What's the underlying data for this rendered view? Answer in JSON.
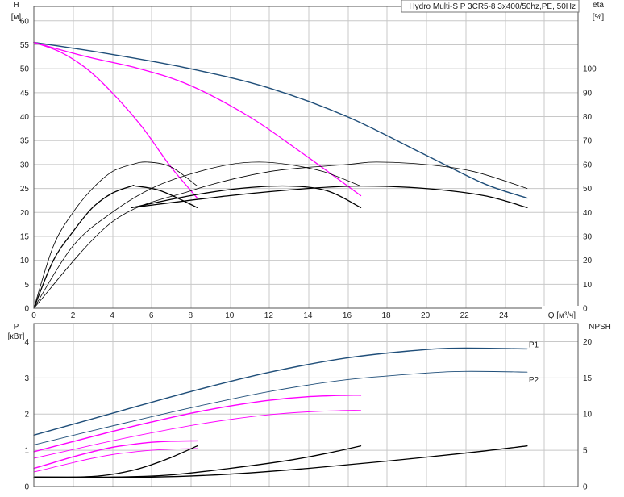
{
  "title": "Hydro Multi-S P 3CR5-8 3x400/50hz,PE, 50Hz",
  "colors": {
    "blue": "#1f4e79",
    "magenta": "#ff00ff",
    "black": "#000000",
    "grid": "#c8c8c8"
  },
  "chart_data": [
    {
      "type": "line",
      "name": "head-efficiency",
      "left_axis": {
        "label": "H",
        "unit": "[м]",
        "ticks": [
          0,
          5,
          10,
          15,
          20,
          25,
          30,
          35,
          40,
          45,
          50,
          55,
          60
        ],
        "range": [
          0,
          63
        ]
      },
      "right_axis": {
        "label": "eta",
        "unit": "[%]",
        "ticks": [
          0,
          10,
          20,
          30,
          40,
          50,
          60,
          70,
          80,
          90,
          100
        ],
        "range": [
          0,
          126
        ]
      },
      "x_axis": {
        "label": "Q [м³/ч]",
        "ticks": [
          0,
          2,
          4,
          6,
          8,
          10,
          12,
          14,
          16,
          18,
          20,
          22,
          24
        ],
        "range": [
          0,
          27.8
        ]
      },
      "grid": true,
      "series": [
        {
          "kind": "head",
          "color": "#1f4e79",
          "width": 1.4,
          "x": [
            0,
            4,
            8,
            12,
            16,
            20,
            23,
            25.2
          ],
          "y": [
            55.5,
            53,
            50,
            46,
            40,
            32,
            26,
            23
          ]
        },
        {
          "kind": "head",
          "color": "#ff00ff",
          "width": 1.3,
          "x": [
            0,
            2.7,
            5.4,
            8,
            11,
            13.5,
            16.7
          ],
          "y": [
            55.5,
            52.5,
            50,
            46.5,
            40,
            33,
            23.5
          ]
        },
        {
          "kind": "head",
          "color": "#ff00ff",
          "width": 1.3,
          "x": [
            0,
            1.35,
            2.7,
            4,
            5.5,
            7,
            8.35
          ],
          "y": [
            55.5,
            53.5,
            50,
            45,
            38,
            29.5,
            23
          ]
        },
        {
          "kind": "eta",
          "color": "#000000",
          "width": 0.8,
          "x": [
            0,
            1,
            2,
            3,
            4,
            5,
            5.8,
            7,
            8.35
          ],
          "y": [
            0,
            26,
            40,
            50,
            57,
            60,
            61,
            59,
            51
          ]
        },
        {
          "kind": "eta",
          "color": "#000000",
          "width": 1.3,
          "x": [
            0,
            1,
            2,
            3,
            4,
            5,
            5.2,
            6.5,
            8.35
          ],
          "y": [
            0,
            20,
            32,
            42,
            48,
            51,
            51,
            49,
            42
          ]
        },
        {
          "kind": "eta",
          "color": "#000000",
          "width": 0.8,
          "x": [
            0,
            2,
            4,
            6,
            8,
            10,
            11.5,
            13,
            14.8,
            16.7
          ],
          "y": [
            0,
            26,
            40,
            50,
            56,
            60,
            61,
            60,
            57,
            51
          ]
        },
        {
          "kind": "eta",
          "color": "#000000",
          "width": 1.3,
          "x": [
            5,
            8,
            10.5,
            13,
            15,
            16.7
          ],
          "y": [
            42,
            47,
            50,
            51,
            49,
            42
          ]
        },
        {
          "kind": "eta",
          "color": "#000000",
          "width": 0.8,
          "x": [
            0,
            4,
            8,
            12,
            16,
            17.5,
            20,
            22.5,
            25.2
          ],
          "y": [
            0,
            36,
            49,
            57,
            60,
            61,
            60,
            57,
            50
          ]
        },
        {
          "kind": "eta",
          "color": "#000000",
          "width": 1.3,
          "x": [
            5,
            10,
            14,
            16.8,
            20,
            23,
            25.2
          ],
          "y": [
            42,
            47,
            50,
            51,
            50,
            47,
            42
          ]
        }
      ]
    },
    {
      "type": "line",
      "name": "power-npsh",
      "left_axis": {
        "label": "P",
        "unit": "[кВт]",
        "ticks": [
          0,
          1,
          2,
          3,
          4
        ],
        "range": [
          0,
          4.5
        ]
      },
      "right_axis": {
        "label": "NPSH",
        "unit": "",
        "ticks": [
          0,
          5,
          10,
          15,
          20
        ],
        "range": [
          0,
          22.5
        ]
      },
      "x_axis": {
        "label": "",
        "ticks": [],
        "range": [
          0,
          27.8
        ]
      },
      "grid": true,
      "labels": {
        "p1": "P1",
        "p2": "P2"
      },
      "series": [
        {
          "kind": "power",
          "color": "#1f4e79",
          "width": 1.4,
          "x": [
            0,
            4,
            8,
            12,
            16,
            20,
            22,
            25.2
          ],
          "y": [
            1.42,
            2.02,
            2.62,
            3.15,
            3.55,
            3.78,
            3.82,
            3.8
          ]
        },
        {
          "kind": "power",
          "color": "#1f4e79",
          "width": 0.9,
          "x": [
            0,
            4,
            8,
            12,
            16,
            20,
            22,
            25.2
          ],
          "y": [
            1.15,
            1.67,
            2.17,
            2.62,
            2.95,
            3.13,
            3.18,
            3.16
          ]
        },
        {
          "kind": "power",
          "color": "#ff00ff",
          "width": 1.4,
          "x": [
            0,
            2,
            4,
            6,
            8,
            10,
            12,
            14,
            16,
            16.7
          ],
          "y": [
            0.96,
            1.24,
            1.52,
            1.78,
            2.02,
            2.22,
            2.38,
            2.48,
            2.52,
            2.52
          ]
        },
        {
          "kind": "power",
          "color": "#ff00ff",
          "width": 0.9,
          "x": [
            0,
            2,
            4,
            6,
            8,
            10,
            12,
            14,
            16,
            16.7
          ],
          "y": [
            0.78,
            1.02,
            1.26,
            1.48,
            1.68,
            1.85,
            1.98,
            2.06,
            2.1,
            2.1
          ]
        },
        {
          "kind": "power",
          "color": "#ff00ff",
          "width": 1.4,
          "x": [
            0,
            1,
            2,
            3,
            4,
            5,
            6,
            7,
            8.35
          ],
          "y": [
            0.5,
            0.66,
            0.82,
            0.96,
            1.08,
            1.16,
            1.22,
            1.25,
            1.26
          ]
        },
        {
          "kind": "power",
          "color": "#ff00ff",
          "width": 0.9,
          "x": [
            0,
            1,
            2,
            3,
            4,
            5,
            6,
            7,
            8.35
          ],
          "y": [
            0.4,
            0.53,
            0.66,
            0.78,
            0.88,
            0.95,
            1.0,
            1.03,
            1.05
          ]
        },
        {
          "kind": "npsh",
          "color": "#000000",
          "width": 1.3,
          "x": [
            0,
            2,
            3.5,
            5,
            6,
            7,
            8.35
          ],
          "y": [
            1.3,
            1.3,
            1.5,
            2.2,
            3.0,
            4.0,
            5.6
          ]
        },
        {
          "kind": "npsh",
          "color": "#000000",
          "width": 1.3,
          "x": [
            0,
            4,
            7,
            10,
            13,
            15,
            16.7
          ],
          "y": [
            1.3,
            1.3,
            1.6,
            2.5,
            3.6,
            4.6,
            5.6
          ]
        },
        {
          "kind": "npsh",
          "color": "#000000",
          "width": 1.3,
          "x": [
            0,
            6,
            10,
            14,
            18,
            22,
            25.2
          ],
          "y": [
            1.3,
            1.3,
            1.7,
            2.5,
            3.5,
            4.6,
            5.6
          ]
        }
      ]
    }
  ]
}
